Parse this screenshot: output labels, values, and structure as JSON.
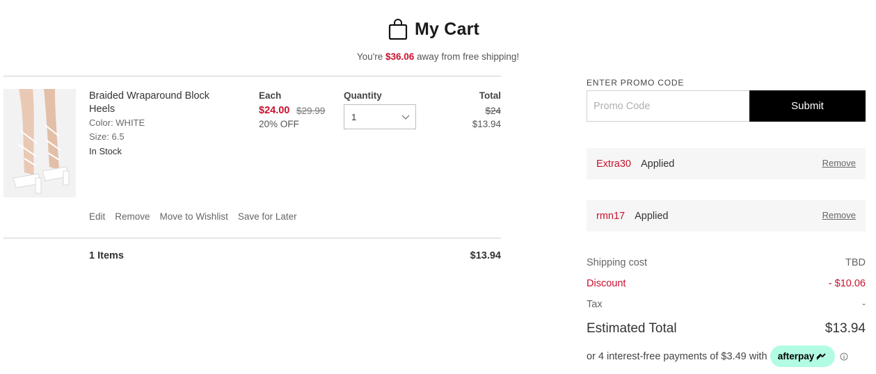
{
  "header": {
    "title": "My Cart",
    "shipping_prefix": "You're ",
    "shipping_amount": "$36.06",
    "shipping_suffix": " away from free shipping!"
  },
  "columns": {
    "each": "Each",
    "quantity": "Quantity",
    "total": "Total"
  },
  "item": {
    "name": "Braided Wraparound Block Heels",
    "color": "Color: WHITE",
    "size": "Size: 6.5",
    "stock": "In Stock",
    "price_now": "$24.00",
    "price_was": "$29.99",
    "discount": "20% OFF",
    "quantity": "1",
    "total_was": "$24",
    "total_now": "$13.94",
    "actions": {
      "edit": "Edit",
      "remove": "Remove",
      "wishlist": "Move to Wishlist",
      "save": "Save for Later"
    }
  },
  "cart_summary": {
    "items_label": "1 Items",
    "items_total": "$13.94"
  },
  "promo": {
    "label": "ENTER PROMO CODE",
    "placeholder": "Promo Code",
    "submit": "Submit"
  },
  "coupons": [
    {
      "code": "Extra30",
      "status": "Applied",
      "remove": "Remove"
    },
    {
      "code": "rmn17",
      "status": "Applied",
      "remove": "Remove"
    }
  ],
  "summary": {
    "shipping_label": "Shipping cost",
    "shipping_value": "TBD",
    "discount_label": "Discount",
    "discount_value": "- $10.06",
    "tax_label": "Tax",
    "tax_value": "-",
    "estimated_label": "Estimated Total",
    "estimated_value": "$13.94"
  },
  "afterpay": {
    "text": "or 4 interest-free payments of $3.49 with",
    "brand": "afterpay"
  },
  "colors": {
    "accent_red": "#c8102e",
    "afterpay_mint": "#b2fce4",
    "submit_black": "#000000"
  },
  "icons": {
    "bag": "shopping-bag-icon",
    "chevron": "chevron-down-icon",
    "info": "info-icon",
    "afterpay_arrows": "afterpay-arrows-icon"
  }
}
